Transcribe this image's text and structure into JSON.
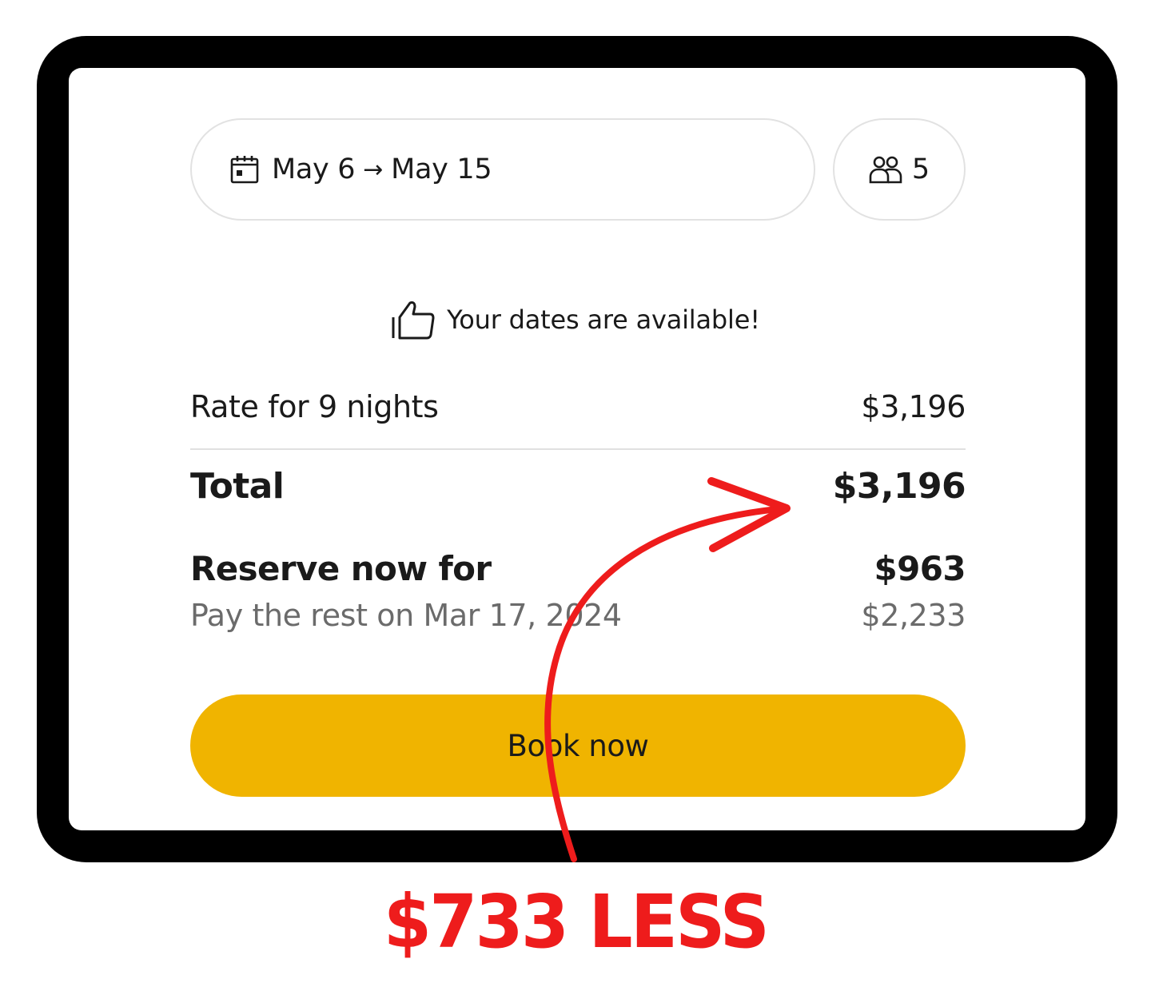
{
  "booking": {
    "date_from": "May 6",
    "date_arrow": "→",
    "date_to": "May 15",
    "guests": "5"
  },
  "availability": {
    "message": "Your dates are available!"
  },
  "pricing": {
    "rate_label": "Rate for 9 nights",
    "rate_value": "$3,196",
    "total_label": "Total",
    "total_value": "$3,196",
    "reserve_label": "Reserve now for",
    "reserve_value": "$963",
    "rest_label": "Pay the rest on Mar 17, 2024",
    "rest_value": "$2,233"
  },
  "actions": {
    "book_label": "Book now"
  },
  "annotation": {
    "callout": "$733 LESS",
    "color": "#ee1c1c"
  },
  "colors": {
    "accent": "#f0b400",
    "text": "#1a1a1a",
    "muted": "#6b6b6b"
  }
}
